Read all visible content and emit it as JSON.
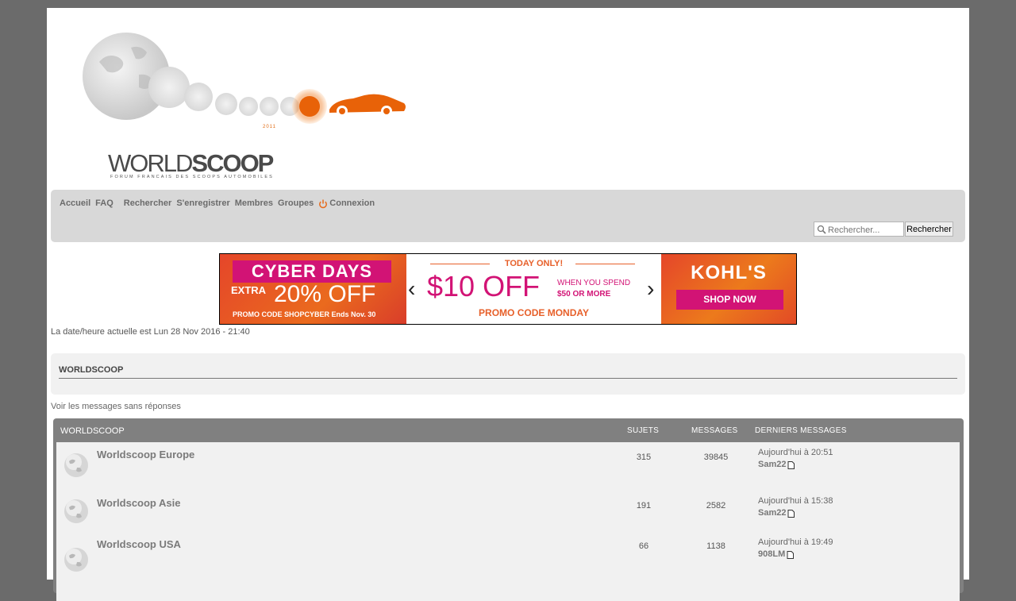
{
  "header": {
    "logo_word_light": "WORLD",
    "logo_word_bold": "SCOOP",
    "logo_subtitle": "FORUM FRANCAIS DES SCOOPS AUTOMOBILES",
    "logo_year": "2011"
  },
  "nav": {
    "items": [
      {
        "label": "Accueil"
      },
      {
        "label": "FAQ"
      },
      {
        "label": "Rechercher"
      },
      {
        "label": "S'enregistrer"
      },
      {
        "label": "Membres"
      },
      {
        "label": "Groupes"
      },
      {
        "label": "Connexion"
      }
    ],
    "search_placeholder": "Rechercher...",
    "search_button": "Rechercher"
  },
  "ad": {
    "left_title": "CYBER DAYS",
    "left_extra": "EXTRA",
    "left_pct": "20% OFF",
    "left_code": "PROMO CODE SHOPCYBER Ends Nov. 30",
    "mid_today": "TODAY ONLY!",
    "mid_big": "$10 OFF",
    "mid_spend_1": "WHEN YOU SPEND",
    "mid_spend_2": "$50 OR MORE",
    "mid_promo": "PROMO CODE MONDAY",
    "right_brand": "KOHL'S",
    "right_shop": "SHOP NOW",
    "accent_pink": "#d21375",
    "accent_orange": "#e7602a"
  },
  "date_line": "La date/heure actuelle est Lun 28 Nov 2016 - 21:40",
  "section_title": "WORLDSCOOP",
  "unanswered_link": "Voir les messages sans réponses",
  "forum": {
    "header": {
      "title": "WORLDSCOOP",
      "topics": "SUJETS",
      "messages": "MESSAGES",
      "last": "DERNIERS MESSAGES"
    },
    "rows": [
      {
        "name": "Worldscoop Europe",
        "topics": "315",
        "messages": "39845",
        "last_time": "Aujourd'hui à 20:51",
        "last_user": "Sam22"
      },
      {
        "name": "Worldscoop Asie",
        "topics": "191",
        "messages": "2582",
        "last_time": "Aujourd'hui à 15:38",
        "last_user": "Sam22"
      },
      {
        "name": "Worldscoop USA",
        "topics": "66",
        "messages": "1138",
        "last_time": "Aujourd'hui à 19:49",
        "last_user": "908LM"
      }
    ]
  }
}
